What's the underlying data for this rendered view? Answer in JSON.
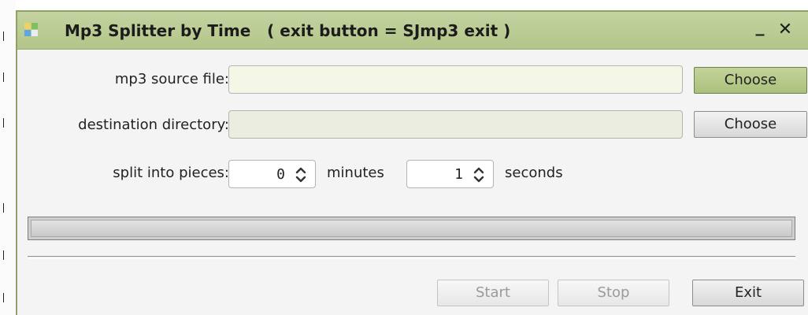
{
  "window": {
    "title": "Mp3 Splitter by Time   ( exit button = SJmp3 exit )",
    "minimize_glyph": "_",
    "close_glyph": "✕",
    "icon": "app-icon"
  },
  "form": {
    "source_label": "mp3 source file:",
    "source_value": "",
    "source_choose": "Choose",
    "dest_label": "destination directory:",
    "dest_value": "",
    "dest_choose": "Choose",
    "split_label": "split into pieces:",
    "minutes_value": "0",
    "minutes_label": "minutes",
    "seconds_value": "1",
    "seconds_label": "seconds"
  },
  "progress": {
    "value": 0
  },
  "buttons": {
    "start": "Start",
    "stop": "Stop",
    "exit": "Exit"
  },
  "colors": {
    "accent": "#b9c991",
    "title_bar": "#bccb96",
    "source_field_bg": "#f5f7e6",
    "dest_field_bg": "#eaede0"
  }
}
